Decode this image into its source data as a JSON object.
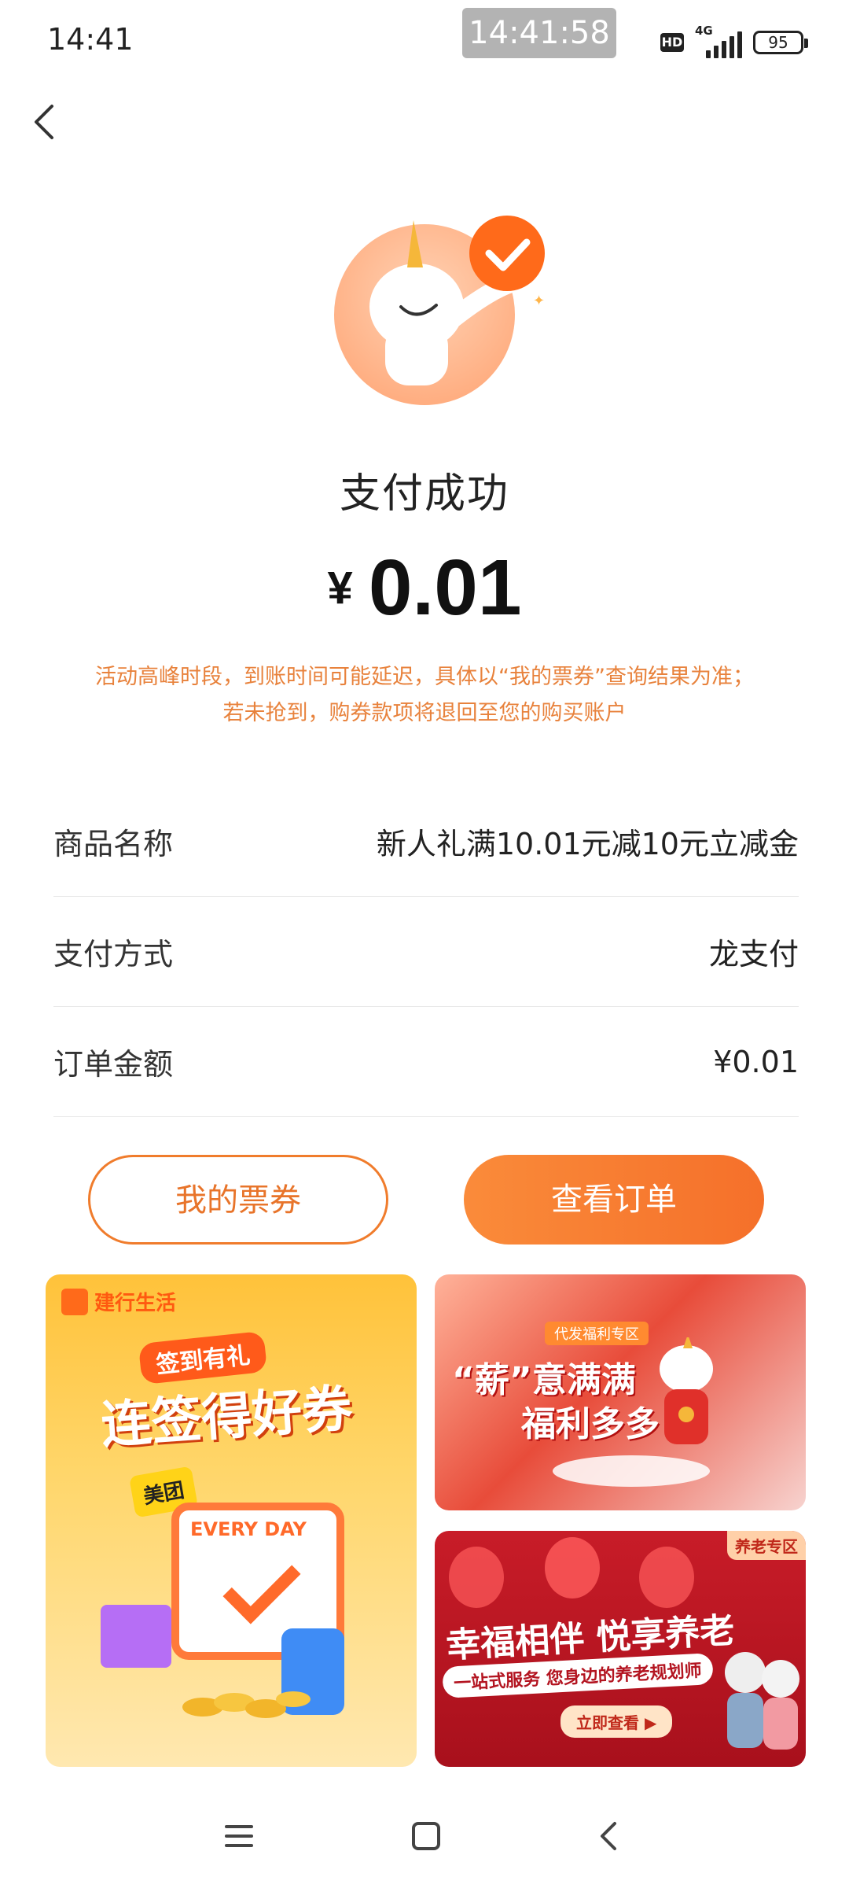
{
  "status_bar": {
    "time": "14:41",
    "clock_overlay": "14:41:58",
    "hd": "HD",
    "network": "4G",
    "battery": "95"
  },
  "page": {
    "title": "支付成功",
    "amount_currency": "¥",
    "amount_value": "0.01",
    "notice_line1": "活动高峰时段，到账时间可能延迟，具体以“我的票券”查询结果为准；",
    "notice_line2": "若未抢到，购券款项将退回至您的购买账户"
  },
  "details": [
    {
      "label": "商品名称",
      "value": "新人礼满10.01元减10元立减金"
    },
    {
      "label": "支付方式",
      "value": "龙支付"
    },
    {
      "label": "订单金额",
      "value": "¥0.01"
    }
  ],
  "buttons": {
    "my_tickets": "我的票券",
    "view_order": "查看订单"
  },
  "banners": {
    "left": {
      "brand": "建行生活",
      "tag": "签到有礼",
      "heading": "连签得好券",
      "meituan": "美团",
      "calendar_text": "EVERY DAY"
    },
    "top_right": {
      "tag": "代发福利专区",
      "line1": "“薪”意满满",
      "line2": "福利多多"
    },
    "bottom_right": {
      "tag": "养老专区",
      "heading": "幸福相伴 悦享养老",
      "sub": "一站式服务 您身边的养老规划师",
      "cta": "立即查看 ▶"
    }
  },
  "colors": {
    "accent": "#f5702a",
    "notice": "#e8823c"
  }
}
